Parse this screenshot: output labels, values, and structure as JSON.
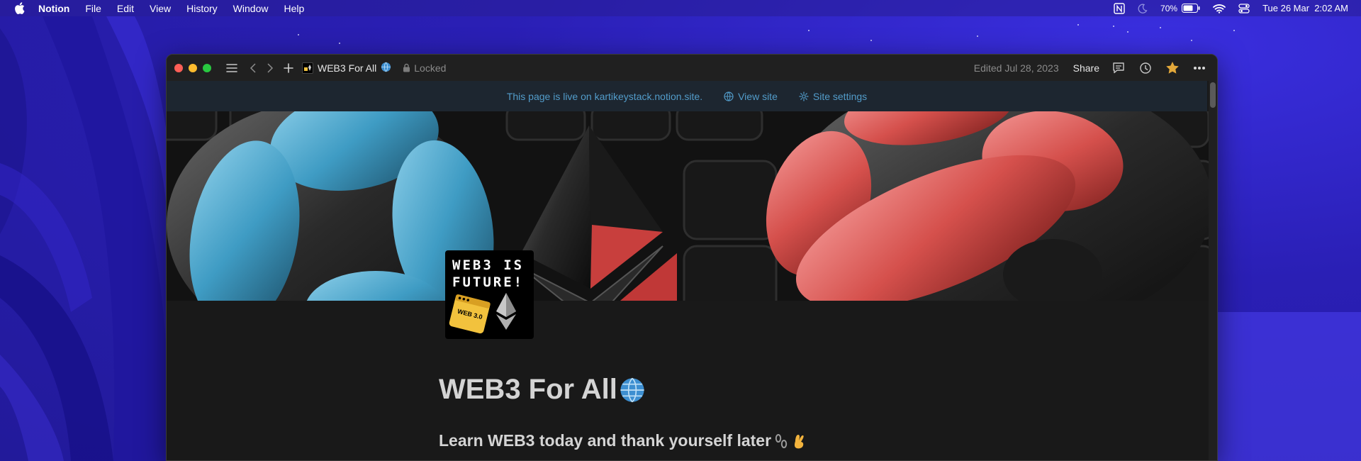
{
  "menubar": {
    "app_name": "Notion",
    "items": [
      "File",
      "Edit",
      "View",
      "History",
      "Window",
      "Help"
    ],
    "battery": "70%",
    "datetime": "Tue 26 Mar  2:02 AM"
  },
  "window": {
    "page_crumb_title": "WEB3 For All",
    "locked_label": "Locked",
    "edited": "Edited Jul 28, 2023",
    "share_label": "Share"
  },
  "banner": {
    "text": "This page is live on kartikeystack.notion.site.",
    "view_site": "View site",
    "site_settings": "Site settings"
  },
  "page": {
    "icon_line1": "WEB3 IS",
    "icon_line2": "FUTURE!",
    "icon_badge": "WEB 3.0",
    "title": "WEB3 For All",
    "subtitle": "Learn WEB3 today and thank yourself later"
  },
  "colors": {
    "window_bg": "#191919",
    "titlebar_bg": "#202020",
    "banner_text": "#529cca",
    "banner_bg": "#1d2630",
    "favorite_star": "#e3a83a"
  }
}
